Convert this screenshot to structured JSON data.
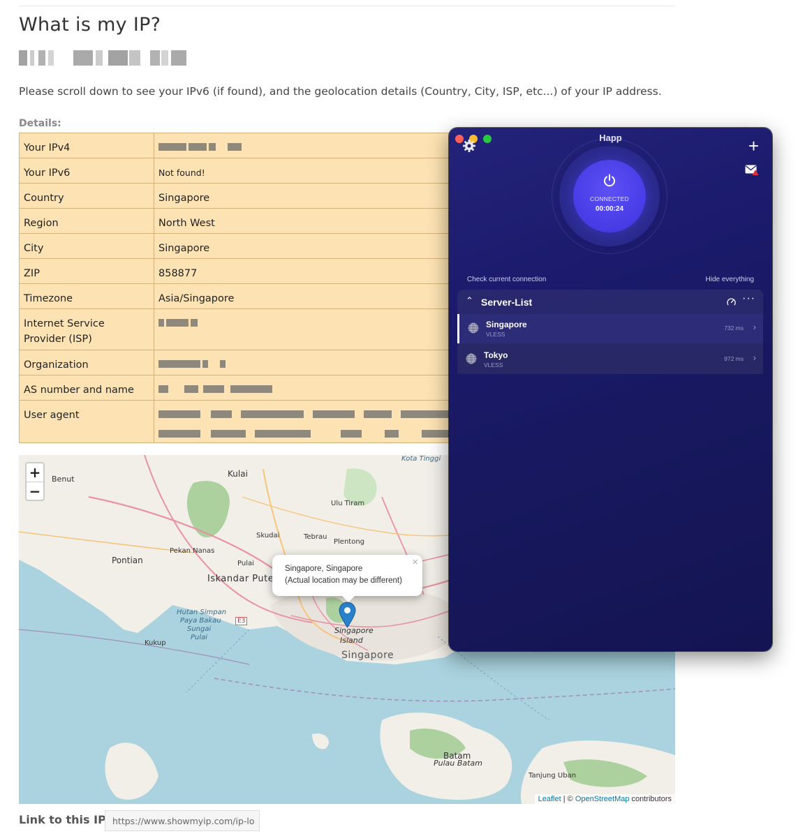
{
  "page": {
    "title": "What is my IP?",
    "intro": "Please scroll down to see your IPv6 (if found), and the geolocation details (Country, City, ISP, etc...) of your IP address.",
    "details_label": "Details:",
    "link_label": "Link to this IP:",
    "link_value": "https://www.showmyip.com/ip-lo"
  },
  "details": [
    {
      "key": "Your IPv4",
      "value": ""
    },
    {
      "key": "Your IPv6",
      "value": "Not found!"
    },
    {
      "key": "Country",
      "value": "Singapore"
    },
    {
      "key": "Region",
      "value": "North West"
    },
    {
      "key": "City",
      "value": "Singapore"
    },
    {
      "key": "ZIP",
      "value": "858877"
    },
    {
      "key": "Timezone",
      "value": "Asia/Singapore"
    },
    {
      "key": "Internet Service Provider (ISP)",
      "value": ""
    },
    {
      "key": "Organization",
      "value": ""
    },
    {
      "key": "AS number and name",
      "value": ""
    },
    {
      "key": "User agent",
      "value": ""
    }
  ],
  "map": {
    "zoom_in": "+",
    "zoom_out": "−",
    "popup_line1": "Singapore, Singapore",
    "popup_line2": "(Actual location may be different)",
    "popup_close": "×",
    "labels": {
      "kota_tinggi": "Kota Tinggi",
      "benut": "Benut",
      "kulai": "Kulai",
      "ulu_tiram": "Ulu Tiram",
      "skudai": "Skudai",
      "tebrau": "Tebrau",
      "plentong": "Plentong",
      "pekan_nanas": "Pekan Nanas",
      "pontian": "Pontian",
      "pulai": "Pulai",
      "iskandar_puteri": "Iskandar Pute",
      "hutan_simpan": "Hutan Simpan",
      "paya_bakau": "Paya Bakau",
      "sungai": "Sungai",
      "pulai2": "Pulai",
      "e3": "E3",
      "kukup": "Kukup",
      "singapore_island": "Singapore",
      "island": "Island",
      "singapore": "Singapore",
      "batam": "Batam",
      "pulau_batam": "Pulau Batam",
      "tanjung_uban": "Tanjung Uban"
    },
    "attribution_leaflet": "Leaflet",
    "attribution_sep": " | © ",
    "attribution_osm": "OpenStreetMap",
    "attribution_tail": " contributors"
  },
  "happ": {
    "title": "Happ",
    "plus": "+",
    "status": "CONNECTED",
    "timer": "00:00:24",
    "check_connection": "Check current connection",
    "hide_everything": "Hide everything",
    "server_list_title": "Server-List",
    "more": "···",
    "servers": [
      {
        "name": "Singapore",
        "protocol": "VLESS",
        "ping": "732 ms"
      },
      {
        "name": "Tokyo",
        "protocol": "VLESS",
        "ping": "972 ms"
      }
    ],
    "colors": {
      "accent": "#4a3ee8",
      "bg": "#1b1a6c",
      "close": "#ff5f57",
      "minimize": "#febc2e",
      "zoom": "#28c840"
    }
  }
}
